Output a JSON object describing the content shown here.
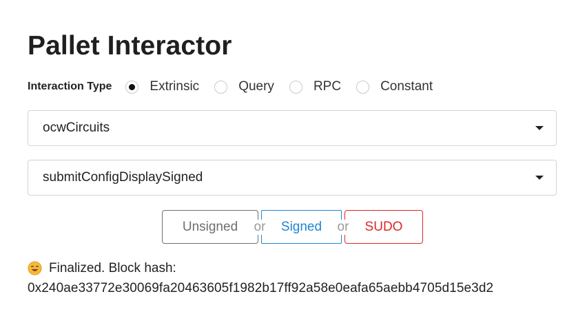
{
  "page": {
    "title": "Pallet Interactor"
  },
  "interaction": {
    "label": "Interaction Type",
    "options": [
      {
        "label": "Extrinsic",
        "selected": true
      },
      {
        "label": "Query",
        "selected": false
      },
      {
        "label": "RPC",
        "selected": false
      },
      {
        "label": "Constant",
        "selected": false
      }
    ]
  },
  "pallet_select": {
    "value": "ocwCircuits"
  },
  "callable_select": {
    "value": "submitConfigDisplaySigned"
  },
  "buttons": {
    "unsigned": "Unsigned",
    "or1": "or",
    "signed": "Signed",
    "or2": "or",
    "sudo": "SUDO"
  },
  "status": {
    "icon": "smiling-face-icon",
    "text": "Finalized. Block hash:",
    "hash": "0x240ae33772e30069fa20463605f1982b17ff92a58e0eafa65aebb4705d15e3d2"
  },
  "colors": {
    "signed": "#2185d0",
    "sudo": "#db2828",
    "unsigned_border": "#6f6f6f"
  }
}
